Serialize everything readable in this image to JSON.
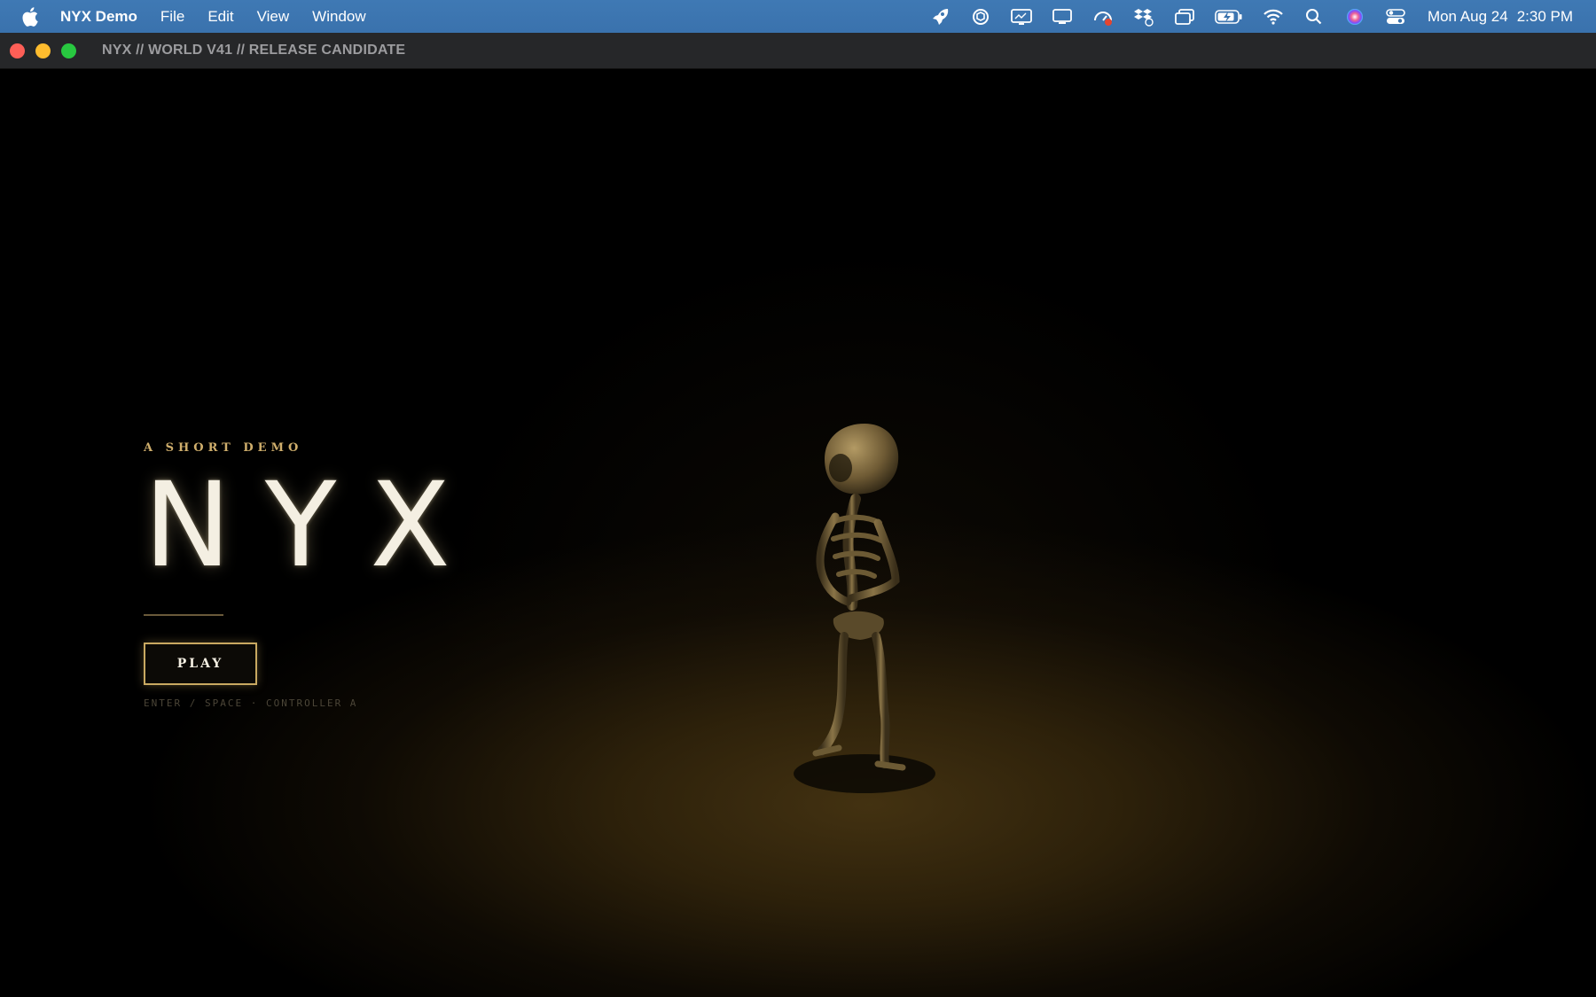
{
  "menubar": {
    "app_name": "NYX Demo",
    "menus": [
      "File",
      "Edit",
      "View",
      "Window"
    ],
    "status_icons": [
      "rocket-icon",
      "openai-icon",
      "display-icon",
      "monitor-icon",
      "gauge-icon",
      "dropbox-icon",
      "window-stack-icon",
      "battery-icon",
      "wifi-icon",
      "spotlight-search-icon",
      "siri-icon",
      "control-center-icon"
    ],
    "date": "Mon Aug 24",
    "time": "2:30 PM"
  },
  "window": {
    "title": "NYX // WORLD V41 // RELEASE CANDIDATE"
  },
  "game": {
    "tagline": "A SHORT DEMO",
    "title": "NYX",
    "play_label": "PLAY",
    "hint": "ENTER / SPACE · CONTROLLER A",
    "accent_color": "#c9a961",
    "title_color": "#f4efe2"
  }
}
